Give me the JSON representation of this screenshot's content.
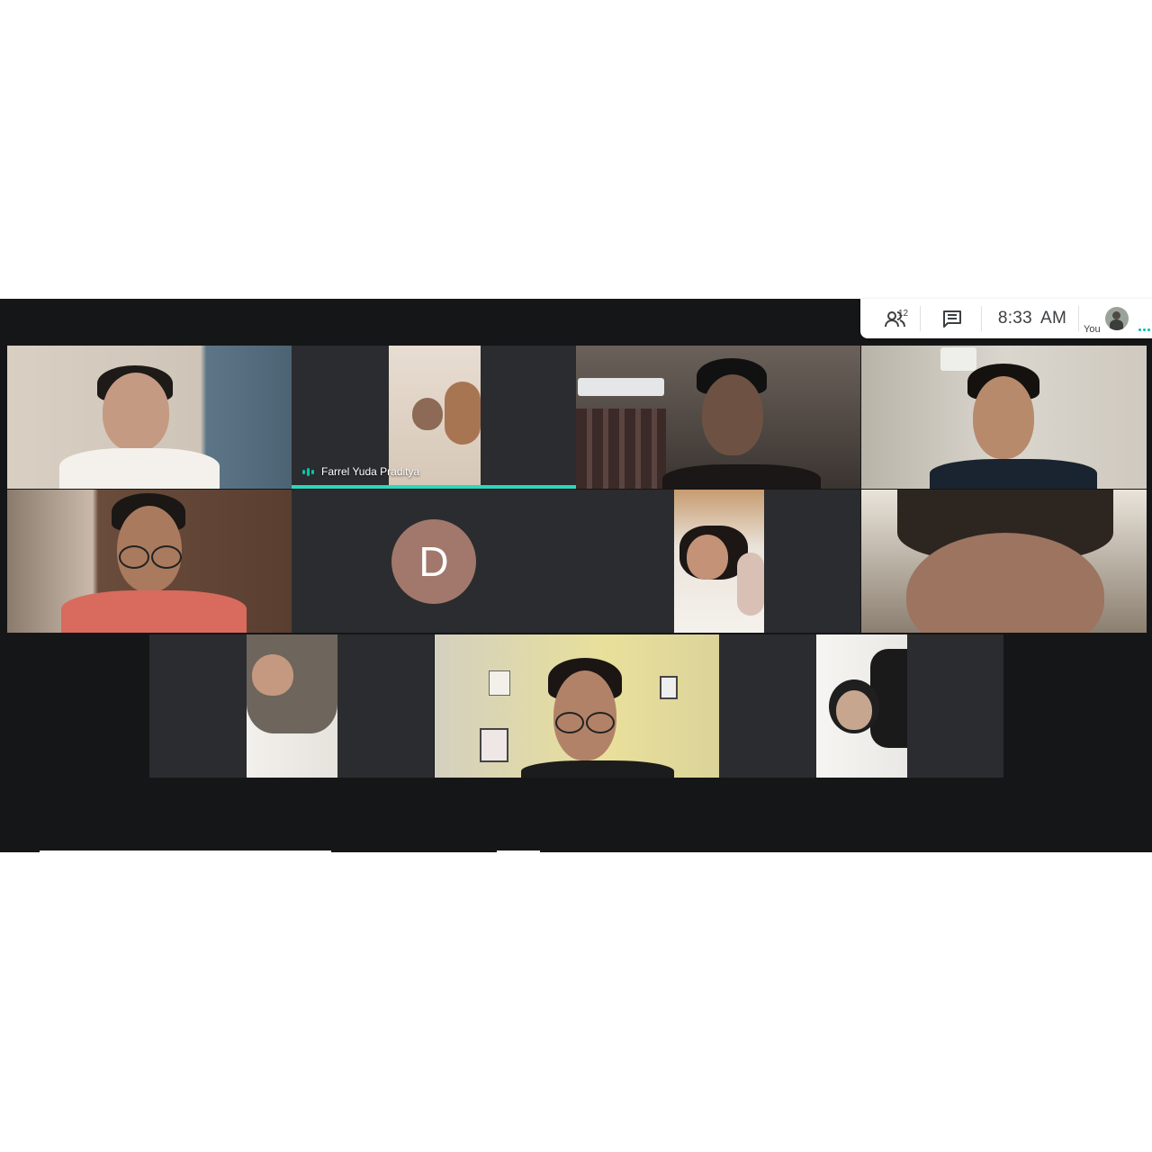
{
  "topbar": {
    "participants_count": "12",
    "time": "8:33",
    "meridiem": "AM",
    "you_label": "You"
  },
  "tiles": {
    "speaking_participant_name": "Farrel Yuda Praditya",
    "avatar_initial": "D"
  },
  "colors": {
    "speaking_accent": "#2fd6be",
    "avatar_bg": "#a1786b",
    "meeting_bg": "#151617",
    "tile_bg": "#2b2c2f"
  },
  "icons": [
    "people-icon",
    "chat-icon",
    "more-options-icon",
    "audio-level-icon"
  ]
}
